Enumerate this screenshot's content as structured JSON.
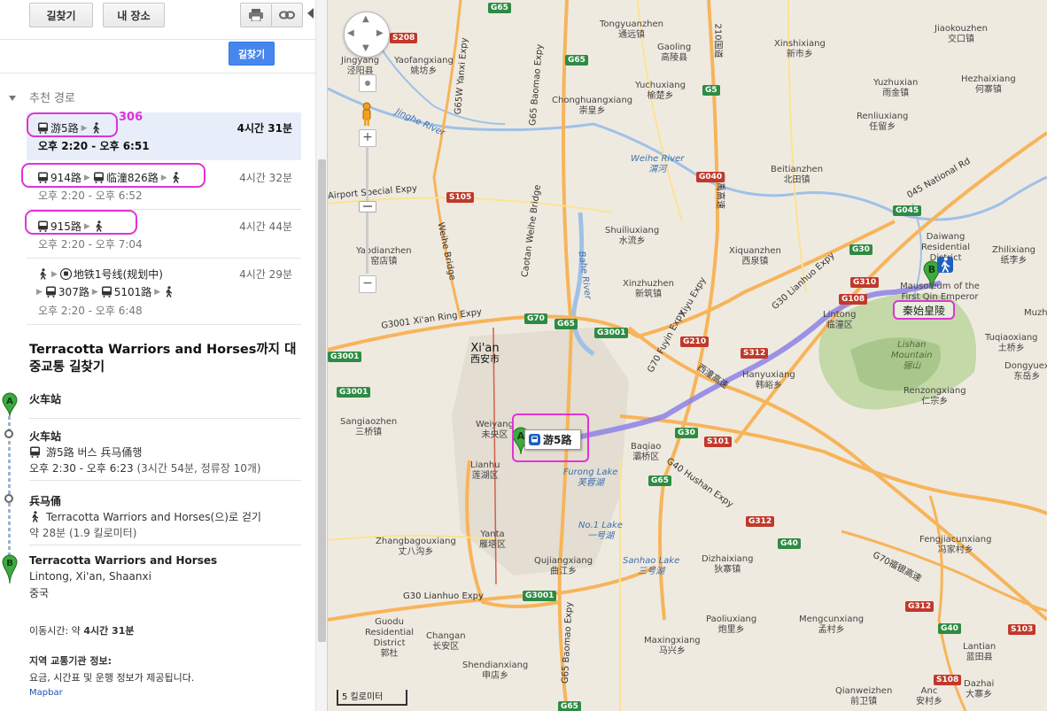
{
  "toolbar": {
    "directions_label": "길찾기",
    "my_places_label": "내 장소",
    "print_icon": "print-icon",
    "link_icon": "link-icon",
    "collapse_icon": "collapse-left-icon"
  },
  "go_button": "길찾기",
  "suggested_routes": {
    "header": "추천 경로",
    "annotation": "306",
    "routes": [
      {
        "lines": [
          "游5路"
        ],
        "duration": "4시간 31분",
        "time": "오후 2:20 - 오후 6:51",
        "selected": true
      },
      {
        "lines": [
          "914路",
          "临潼826路"
        ],
        "duration": "4시간 32분",
        "time": "오후 2:20 - 오후 6:52",
        "selected": false
      },
      {
        "lines": [
          "915路"
        ],
        "duration": "4시간 44분",
        "time": "오후 2:20 - 오후 7:04",
        "selected": false
      },
      {
        "line_a": "地铁1号线(规划中)",
        "lines": [
          "307路",
          "5101路"
        ],
        "duration": "4시간 29분",
        "time": "오후 2:20 - 오후 6:48",
        "selected": false
      }
    ]
  },
  "directions": {
    "title": "Terracotta Warriors and Horses까지 대중교통 길찾기",
    "start": {
      "pin": "A",
      "name": "火车站"
    },
    "step1": {
      "name": "火车站",
      "desc": "游5路 버스 兵马俑행",
      "time": "오후 2:30 - 오후 6:23",
      "extra": "(3시간 54분, 정류장 10개)"
    },
    "step2": {
      "name": "兵马俑",
      "desc": "Terracotta Warriors and Horses(으)로 걷기",
      "dist": "약 28분 (1.9 킬로미터)"
    },
    "end": {
      "pin": "B",
      "name": "Terracotta Warriors and Horses",
      "addr1": "Lintong, Xi'an, Shaanxi",
      "addr2": "중국"
    },
    "travel_time_label": "이동시간: 약",
    "travel_time_value": "4시간 31분",
    "transit_info_title": "지역 교통기관 정보:",
    "transit_info_text": "요금, 시간표 및 운행 정보가 제공됩니다.",
    "provider": "Mapbar"
  },
  "map": {
    "scale_label": "5 킬로미터",
    "route_label": "游5路",
    "dest_label": "秦始皇陵",
    "pin_a": "A",
    "pin_b": "B",
    "places": [
      {
        "en": "Tongyuanzhen",
        "zh": "通远镇"
      },
      {
        "en": "Gaoling",
        "zh": "高陵县"
      },
      {
        "en": "Xinshixiang",
        "zh": "新市乡"
      },
      {
        "en": "Jiaokouzhen",
        "zh": "交口镇"
      },
      {
        "en": "Jingyang",
        "zh": "泾阳县"
      },
      {
        "en": "Yaofangxiang",
        "zh": "姚坊乡"
      },
      {
        "en": "Yuchuxiang",
        "zh": "榆楚乡"
      },
      {
        "en": "Hezhaixiang",
        "zh": "何寨镇"
      },
      {
        "en": "Yuzhuxian",
        "zh": "雨金镇"
      },
      {
        "en": "Chonghuangxiang",
        "zh": "崇皇乡"
      },
      {
        "en": "Renliuxiang",
        "zh": "任留乡"
      },
      {
        "en": "Beitianzhen",
        "zh": "北田镇"
      },
      {
        "en": "Yaodianzhen",
        "zh": "窑店镇"
      },
      {
        "en": "Shuiliuxiang",
        "zh": "水流乡"
      },
      {
        "en": "Xiquanzhen",
        "zh": "西泉镇"
      },
      {
        "en": "Daiwang Residential District",
        "zh": ""
      },
      {
        "en": "Zhilixiang",
        "zh": "纸李乡"
      },
      {
        "en": "Xinzhuzhen",
        "zh": "新筑镇"
      },
      {
        "en": "Lintong",
        "zh": "临潼区"
      },
      {
        "en": "Mausoleum of the First Qin Emperor",
        "zh": ""
      },
      {
        "en": "Muzh",
        "zh": ""
      },
      {
        "en": "Tuqiaoxiang",
        "zh": "土桥乡"
      },
      {
        "en": "Lishan Mountain",
        "zh": "骊山"
      },
      {
        "en": "Dongyuex",
        "zh": "东岳乡"
      },
      {
        "en": "Xi'an",
        "zh": "西安市"
      },
      {
        "en": "Hanyuxiang",
        "zh": "韩峪乡"
      },
      {
        "en": "Renzongxiang",
        "zh": "仁宗乡"
      },
      {
        "en": "Sangiaozhen",
        "zh": "三桥镇"
      },
      {
        "en": "Weiyang",
        "zh": "未央区"
      },
      {
        "en": "Baqiao",
        "zh": "灞桥区"
      },
      {
        "en": "Lianhu",
        "zh": "莲湖区"
      },
      {
        "en": "Furong Lake",
        "zh": "芙蓉湖"
      },
      {
        "en": "Yanta",
        "zh": "雁塔区"
      },
      {
        "en": "No.1 Lake",
        "zh": "一号湖"
      },
      {
        "en": "Zhangbagouxiang",
        "zh": "丈八沟乡"
      },
      {
        "en": "Fengjiacunxiang",
        "zh": "冯家村乡"
      },
      {
        "en": "Qujiangxiang",
        "zh": "曲江乡"
      },
      {
        "en": "Sanhao Lake",
        "zh": "三号湖"
      },
      {
        "en": "Dizhaixiang",
        "zh": "狄寨镇"
      },
      {
        "en": "Paoliuxiang",
        "zh": "炮里乡"
      },
      {
        "en": "Mengcunxiang",
        "zh": "孟村乡"
      },
      {
        "en": "Guodu Residential District",
        "zh": "郭杜"
      },
      {
        "en": "Changan",
        "zh": "长安区"
      },
      {
        "en": "Maxingxiang",
        "zh": "马兴乡"
      },
      {
        "en": "Lantian",
        "zh": "蓝田县"
      },
      {
        "en": "Shendianxiang",
        "zh": "申店乡"
      },
      {
        "en": "Qianweizhen",
        "zh": "前卫镇"
      },
      {
        "en": "Anc",
        "zh": "安村乡"
      },
      {
        "en": "Dazhai",
        "zh": "大寨乡"
      }
    ],
    "roads": {
      "g3001_xian_ring": "G3001 Xi'an Ring Expy",
      "g70_fuyin": "G70 Fuyin Expy",
      "g30_lianhuo_e": "G30 Lianhuo Expy",
      "g30_lianhuo_s": "G30 Lianhuo Expy",
      "g40_hushan": "G40 Hushan Expy",
      "g65_baomao_n": "G65 Baomao Expy",
      "g65_baomao_s": "G65 Baomao Expy",
      "g65w_yanxi": "G65W Yanxi Expy",
      "airport": "Airport Special Expy",
      "weihe_bridge": "Weihe Bridge",
      "caotan": "Caotan Weihe Bridge",
      "xiyu": "Xiyu Expy",
      "national_045": "045 National Rd",
      "weihe_river": "Weihe River",
      "weihe_river_zh": "渭河",
      "jinghe_river": "Jinghe River",
      "bahe_river": "Bahe River",
      "g70_zh": "G70福银高速",
      "xitong": "西潼高速",
      "xiyu_zh": "西禹高速",
      "national_210": "210国道",
      "xiyuan": "西潼高速"
    },
    "shields": [
      "G65",
      "G65",
      "G5",
      "S208",
      "G040",
      "S105",
      "G30",
      "G045",
      "G3001",
      "G70",
      "G65",
      "G3001",
      "G310",
      "G108",
      "G210",
      "S312",
      "G30",
      "S101",
      "G65",
      "G312",
      "G40",
      "G312",
      "G40",
      "G3001",
      "S108",
      "S103",
      "G65",
      "G3001"
    ]
  }
}
